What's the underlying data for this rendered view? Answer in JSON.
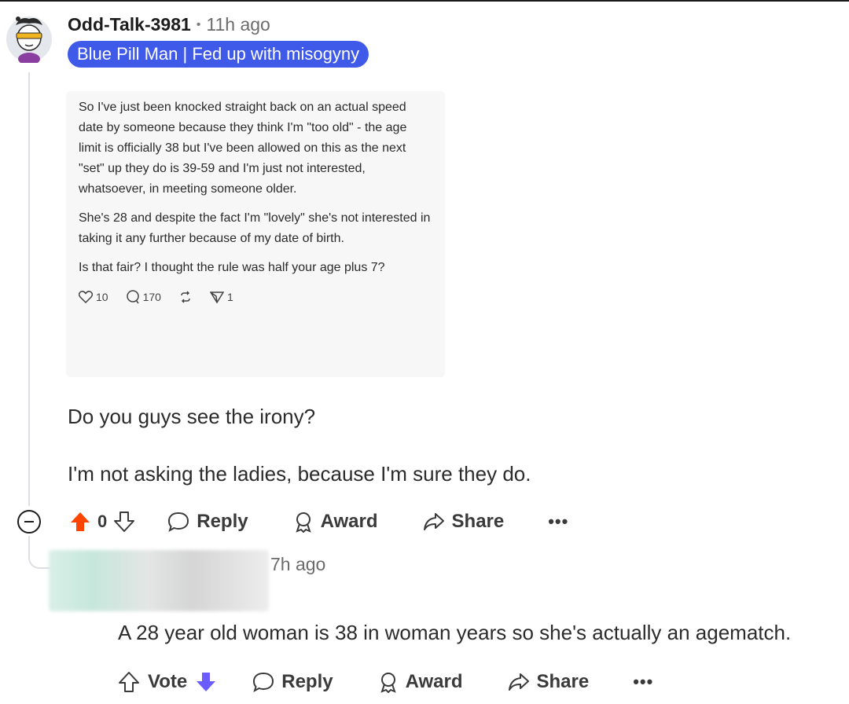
{
  "comment": {
    "username": "Odd-Talk-3981",
    "separator": "•",
    "time": "11h ago",
    "flair": "Blue Pill Man | Fed up with misogyny",
    "embed": {
      "paragraphs": [
        "So I've just been knocked straight back on an actual speed date by someone because they think I'm \"too old\" - the age limit is officially 38 but I've been allowed on this as the next \"set\" up they do is 39-59 and I'm just not interested, whatsoever, in meeting someone older.",
        "She's 28 and despite the fact I'm \"lovely\" she's not interested in taking it any further because of my date of birth.",
        "Is that fair?  I thought the rule was half your age plus 7?"
      ],
      "likes": "10",
      "comments": "170",
      "shares": "1"
    },
    "line1": "Do you guys see the irony?",
    "line2": "I'm not asking the ladies, because I'm sure they do.",
    "score": "0",
    "reply_label": "Reply",
    "award_label": "Award",
    "share_label": "Share",
    "more_label": "•••",
    "upvote_color": "#ff4500"
  },
  "reply": {
    "time": "7h ago",
    "text": "A 28 year old woman is 38 in woman years so she's actually an agematch.",
    "vote_label": "Vote",
    "reply_label": "Reply",
    "award_label": "Award",
    "share_label": "Share",
    "more_label": "•••",
    "downvote_color": "#6a5cff"
  },
  "colors": {
    "flair_bg": "#3f59e8",
    "thread_line": "#dcdfe3"
  }
}
